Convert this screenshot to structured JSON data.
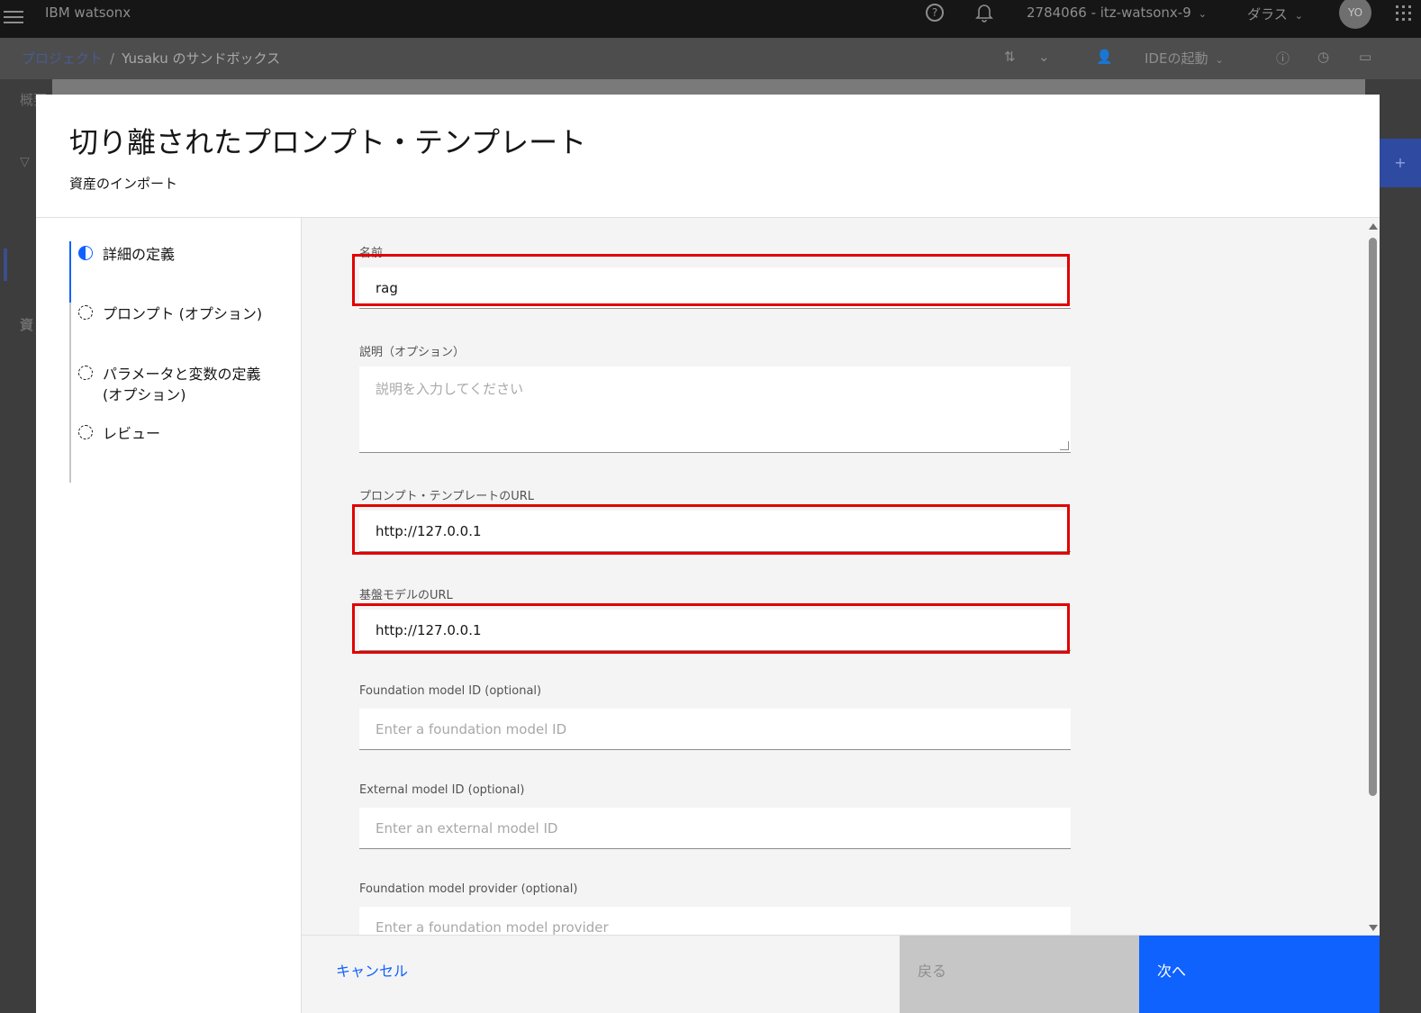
{
  "topbar": {
    "brand": "IBM watsonx",
    "help_icon": "?",
    "account": "2784066 - itz-watsonx-9",
    "region": "ダラス",
    "avatar": "YO",
    "chevron": "⌄"
  },
  "breadcrumb": {
    "projects": "プロジェクト",
    "separator": "/",
    "current": "Yusaku のサンドボックス"
  },
  "toolbar": {
    "ide_label": "IDEの起動"
  },
  "background": {
    "tab_peek": "概要",
    "asset_peek": "資",
    "add_peek": "+"
  },
  "modal": {
    "title": "切り離されたプロンプト・テンプレート",
    "subtitle": "資産のインポート",
    "steps": [
      {
        "label": "詳細の定義",
        "state": "current"
      },
      {
        "label": "プロンプト (オプション)",
        "state": "incomplete"
      },
      {
        "label_line1": "パラメータと変数の定義",
        "label_line2": "(オプション)",
        "state": "incomplete"
      },
      {
        "label": "レビュー",
        "state": "incomplete"
      }
    ],
    "fields": {
      "name": {
        "label": "名前",
        "value": "rag"
      },
      "description": {
        "label": "説明（オプション）",
        "placeholder": "説明を入力してください"
      },
      "prompt_template_url": {
        "label": "プロンプト・テンプレートのURL",
        "value": "http://127.0.0.1"
      },
      "foundation_model_url": {
        "label": "基盤モデルのURL",
        "value": "http://127.0.0.1"
      },
      "foundation_model_id": {
        "label": "Foundation model ID (optional)",
        "placeholder": "Enter a foundation model ID"
      },
      "external_model_id": {
        "label": "External model ID (optional)",
        "placeholder": "Enter an external model ID"
      },
      "foundation_model_provider": {
        "label": "Foundation model provider (optional)",
        "placeholder": "Enter a foundation model provider"
      }
    },
    "footer": {
      "cancel": "キャンセル",
      "back": "戻る",
      "next": "次へ"
    }
  },
  "colors": {
    "accent": "#0f62fe",
    "highlight": "#e00000",
    "topbar": "#161616"
  }
}
